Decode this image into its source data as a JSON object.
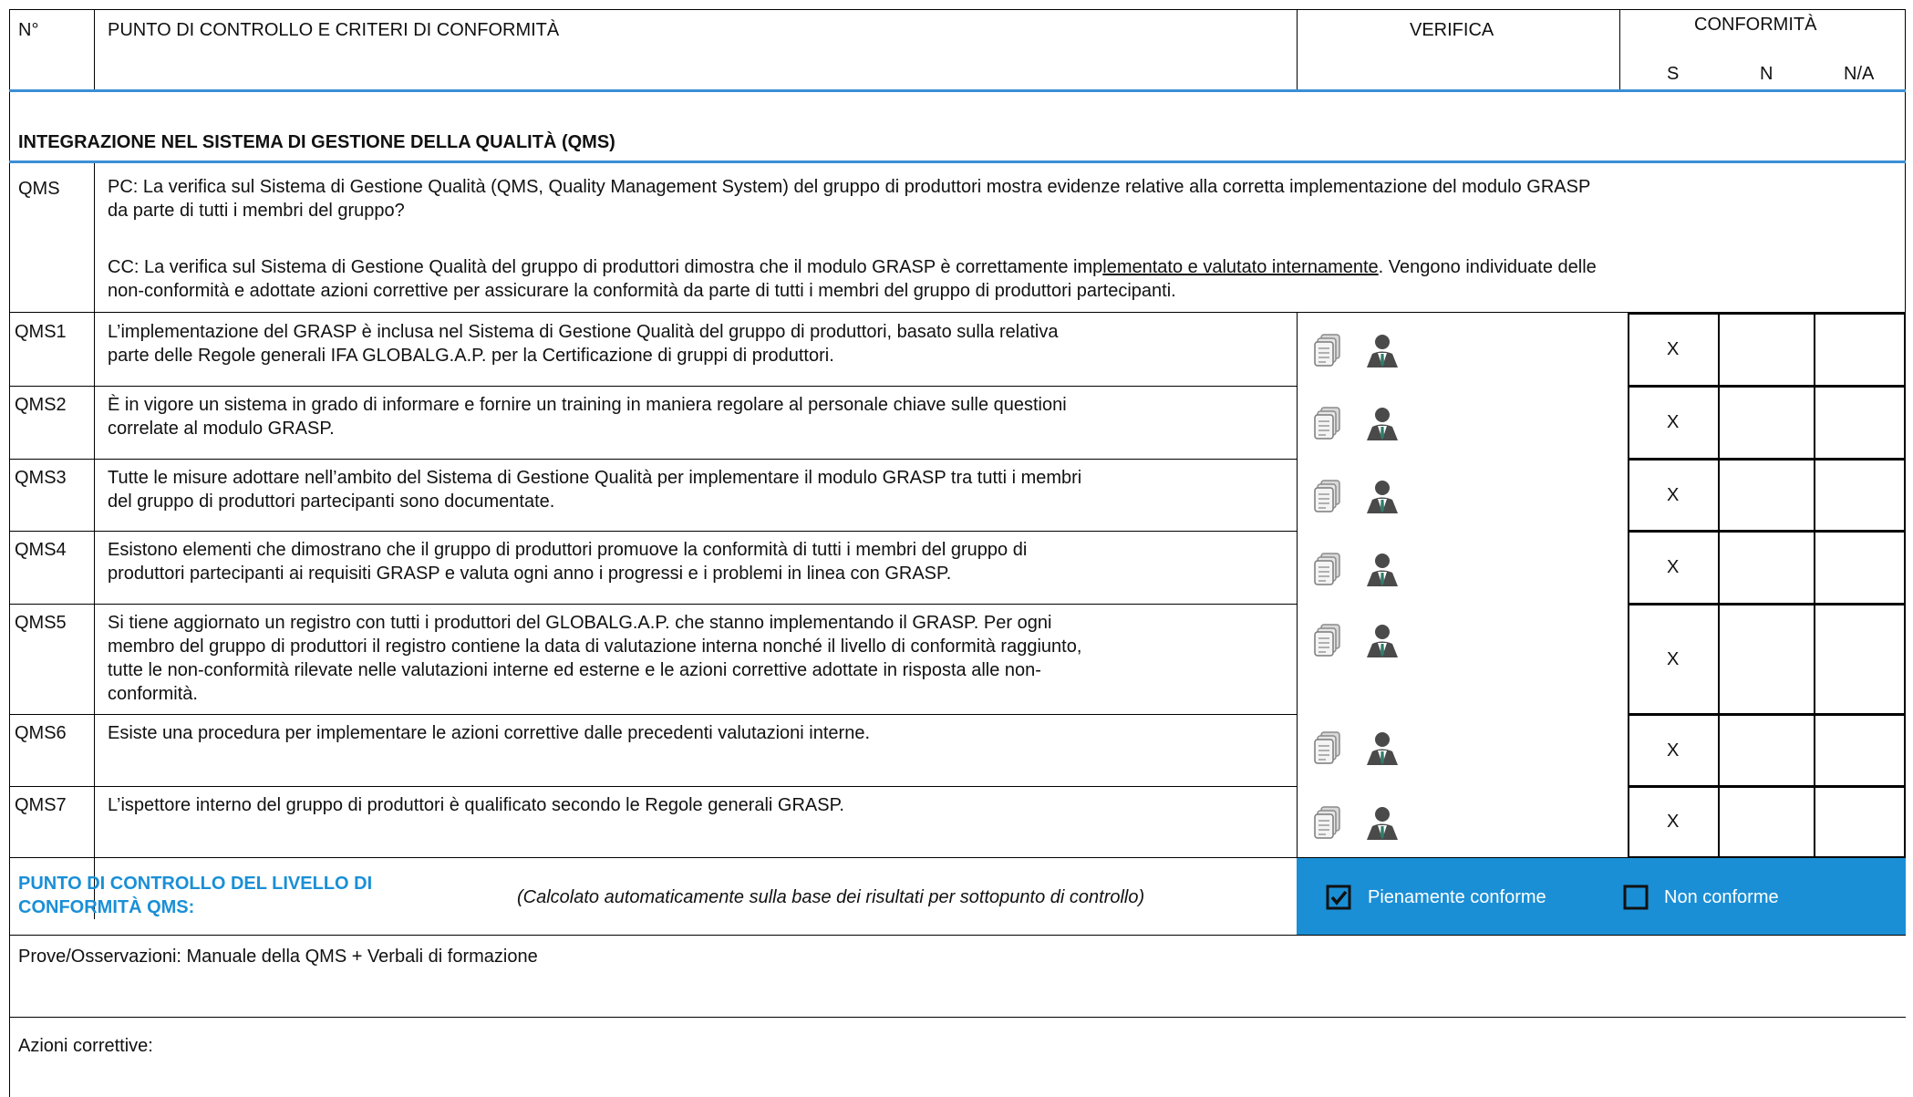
{
  "header": {
    "num": "N°",
    "title": "PUNTO DI CONTROLLO E CRITERI DI CONFORMITÀ",
    "verifica": "VERIFICA",
    "conformita": "CONFORMITÀ",
    "s": "S",
    "n": "N",
    "na": "N/A"
  },
  "section": {
    "title": "INTEGRAZIONE NEL SISTEMA DI GESTIONE DELLA QUALITÀ (QMS)"
  },
  "qms": {
    "code": "QMS",
    "pc_line1": "PC: La verifica sul Sistema di Gestione Qualità (QMS, Quality Management System) del gruppo di produttori mostra evidenze relative alla corretta implementazione del modulo GRASP",
    "pc_line2": "da parte di tutti i membri del gruppo?",
    "cc_line1_a": "CC: La verifica sul Sistema di Gestione Qualità del gruppo di produttori dimostra che il modulo GRASP è correttamente imp",
    "cc_line1_b": "lementato e valutato internamente",
    "cc_line1_c": ". Vengono individuate delle",
    "cc_line2": "non-conformità e adottate azioni correttive per assicurare la conformità da parte di tutti i membri del gruppo di produttori partecipanti."
  },
  "rows": [
    {
      "code": "QMS1",
      "lines": [
        "L’implementazione del GRASP è inclusa nel Sistema di Gestione Qualità del gruppo di produttori, basato sulla relativa",
        "parte delle Regole generali IFA GLOBALG.A.P. per la Certificazione di gruppi di produttori."
      ],
      "s": "X",
      "n": "",
      "na": ""
    },
    {
      "code": "QMS2",
      "lines": [
        "È in vigore un sistema in grado di informare e fornire un training in maniera regolare al personale chiave sulle questioni",
        "correlate al modulo GRASP."
      ],
      "s": "X",
      "n": "",
      "na": ""
    },
    {
      "code": "QMS3",
      "lines": [
        "Tutte le misure adottare nell’ambito del Sistema di Gestione Qualità per implementare il modulo GRASP tra tutti i membri",
        "del gruppo di produttori partecipanti sono documentate."
      ],
      "s": "X",
      "n": "",
      "na": ""
    },
    {
      "code": "QMS4",
      "lines": [
        "Esistono elementi che dimostrano che il gruppo di produttori promuove la conformità di tutti i membri del gruppo di",
        "produttori partecipanti ai requisiti GRASP e valuta ogni anno i progressi e i problemi in linea con GRASP."
      ],
      "s": "X",
      "n": "",
      "na": ""
    },
    {
      "code": "QMS5",
      "lines": [
        "Si tiene aggiornato un registro con tutti i produttori del GLOBALG.A.P. che stanno implementando il GRASP. Per ogni",
        "membro del gruppo di produttori il registro contiene la data di valutazione interna nonché il livello di conformità raggiunto,",
        "tutte le non-conformità rilevate nelle valutazioni interne ed esterne e le azioni correttive adottate in risposta alle non-",
        "conformità."
      ],
      "s": "X",
      "n": "",
      "na": ""
    },
    {
      "code": "QMS6",
      "lines": [
        "Esiste una procedura per implementare le azioni correttive dalle precedenti valutazioni interne."
      ],
      "s": "X",
      "n": "",
      "na": ""
    },
    {
      "code": "QMS7",
      "lines": [
        "L’ispettore interno del gruppo di produttori è qualificato secondo le Regole generali GRASP."
      ],
      "s": "X",
      "n": "",
      "na": ""
    }
  ],
  "summary": {
    "label_line1": "PUNTO DI CONTROLLO DEL LIVELLO DI",
    "label_line2": "CONFORMITÀ QMS:",
    "note": "(Calcolato automaticamente sulla base dei risultati per sottopunto di controllo)",
    "option_full": "Pienamente conforme",
    "option_full_checked": true,
    "option_non": "Non conforme",
    "option_non_checked": false
  },
  "observations": {
    "label": "Prove/Osservazioni: Manuale della QMS + Verbali di formazione"
  },
  "corrective": {
    "label": "Azioni correttive:"
  },
  "colors": {
    "accent": "#1a8fd6",
    "rule_blue": "#3a8fd6",
    "icon_gray": "#9a9a9a",
    "person_dark": "#4a4a4a",
    "person_green": "#2e7d6b"
  },
  "icons": [
    "document-icon",
    "inspector-icon",
    "checkbox-checked-icon",
    "checkbox-empty-icon"
  ]
}
